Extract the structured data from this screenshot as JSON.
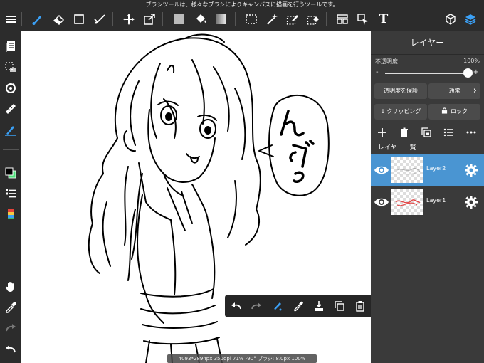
{
  "tooltip": "ブラシツールは、様々なブラシによりキャンバスに描画を行うツールです。",
  "topbar": {
    "tools": [
      "menu-icon",
      "brush-icon",
      "eraser-icon",
      "rectangle-icon",
      "smudge-icon",
      "move-icon",
      "transform-icon",
      "fill-color-icon",
      "bucket-icon",
      "gradient-icon",
      "select-rect-icon",
      "magic-wand-icon",
      "select-pen-icon",
      "select-eraser-icon",
      "panel-layout-icon",
      "select-arrow-icon",
      "text-icon",
      "material-icon",
      "layers-icon"
    ],
    "text_tool_label": "T"
  },
  "panel": {
    "title": "レイヤー",
    "opacity_label": "不透明度",
    "opacity_value": "100%",
    "opacity_fraction": 1.0,
    "slider_minus": "-",
    "slider_plus": "+",
    "protect_alpha": "透明度を保護",
    "blend_mode": "通常",
    "blend_arrow": "›",
    "clipping": "クリッピング",
    "lock": "ロック",
    "layers_header": "レイヤー一覧",
    "layers": [
      {
        "name": "Layer2",
        "active": true
      },
      {
        "name": "Layer1",
        "active": false
      }
    ]
  },
  "status": "4093*2894px 350dpi 71% -90° ブラシ: 8.0px 100%",
  "colors": {
    "accent": "#4a95d2",
    "primary_color": "#000000",
    "secondary_color": "#4de07a"
  }
}
